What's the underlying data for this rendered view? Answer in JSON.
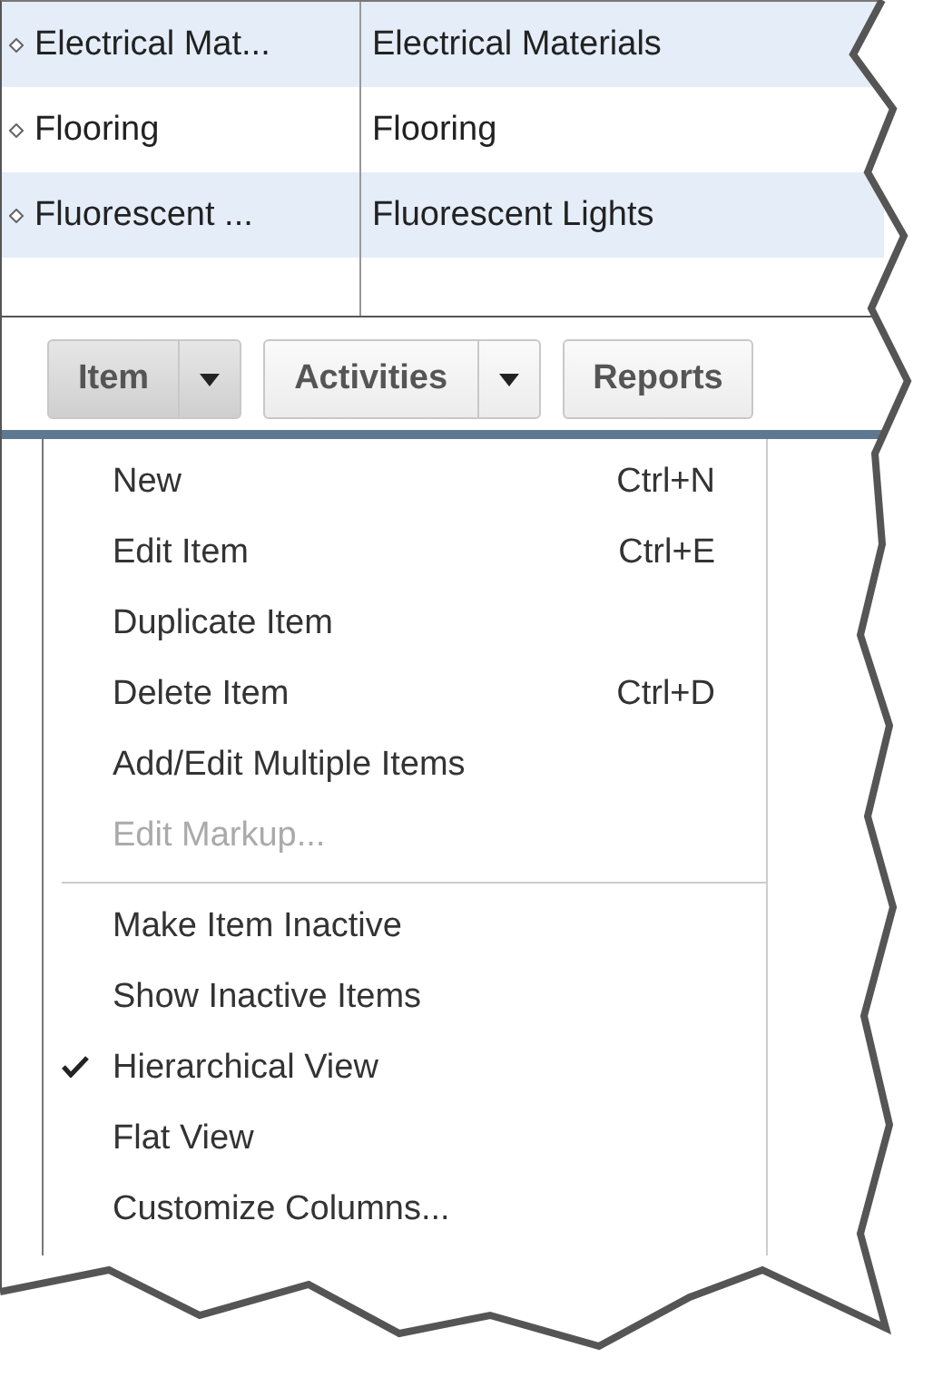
{
  "item_list": {
    "rows": [
      {
        "name": "Electrical Mat...",
        "description": "Electrical Materials",
        "selected": true
      },
      {
        "name": "Flooring",
        "description": "Flooring",
        "selected": false
      },
      {
        "name": "Fluorescent ...",
        "description": "Fluorescent Lights",
        "selected": true
      }
    ]
  },
  "toolbar": {
    "buttons": [
      {
        "label": "Item",
        "pressed": true,
        "has_menu": true
      },
      {
        "label": "Activities",
        "pressed": false,
        "has_menu": true
      },
      {
        "label": "Reports",
        "pressed": false,
        "has_menu": false
      }
    ]
  },
  "item_menu": {
    "groups": [
      {
        "items": [
          {
            "label": "New",
            "shortcut": "Ctrl+N",
            "disabled": false
          },
          {
            "label": "Edit Item",
            "shortcut": "Ctrl+E",
            "disabled": false
          },
          {
            "label": "Duplicate Item",
            "disabled": false
          },
          {
            "label": "Delete Item",
            "shortcut": "Ctrl+D",
            "disabled": false
          },
          {
            "label": "Add/Edit Multiple Items",
            "disabled": false
          },
          {
            "label": "Edit Markup...",
            "disabled": true
          }
        ]
      },
      {
        "items": [
          {
            "label": "Make Item Inactive",
            "disabled": false,
            "checked": false
          },
          {
            "label": "Show Inactive Items",
            "disabled": false,
            "checked": false
          },
          {
            "label": "Hierarchical View",
            "disabled": false,
            "checked": true
          },
          {
            "label": "Flat View",
            "disabled": false,
            "checked": false
          },
          {
            "label": "Customize Columns...",
            "disabled": false,
            "checked": false
          }
        ]
      }
    ]
  }
}
